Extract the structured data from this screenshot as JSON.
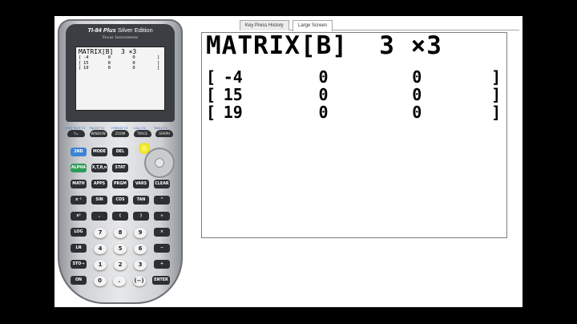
{
  "calculator": {
    "brand": "TI-84 Plus",
    "edition": "Silver Edition",
    "maker": "Texas Instruments",
    "lcd_title": "MATRIX[B]  3 ×3",
    "lcd_rows": [
      [
        "[",
        "-4",
        "0",
        "0",
        "]"
      ],
      [
        "[",
        "15",
        "0",
        "0",
        "]"
      ],
      [
        "[",
        "19",
        "0",
        "0",
        "]"
      ]
    ],
    "fn_keys": [
      "Y=",
      "WINDOW",
      "ZOOM",
      "TRACE",
      "GRAPH"
    ],
    "fn_labels": [
      "STAT PLOT F1",
      "TBLSET F2",
      "FORMAT F3",
      "CALC F4",
      "TABLE F5"
    ],
    "keys": [
      [
        "2ND",
        "MODE",
        "DEL",
        "",
        ""
      ],
      [
        "ALPHA",
        "X,T,θ,n",
        "STAT",
        "",
        ""
      ],
      [
        "MATH",
        "APPS",
        "PRGM",
        "VARS",
        "CLEAR"
      ],
      [
        "x⁻¹",
        "SIN",
        "COS",
        "TAN",
        "^"
      ],
      [
        "x²",
        ",",
        "(",
        ")",
        "÷"
      ],
      [
        "LOG",
        "7",
        "8",
        "9",
        "×"
      ],
      [
        "LN",
        "4",
        "5",
        "6",
        "−"
      ],
      [
        "STO→",
        "1",
        "2",
        "3",
        "+"
      ],
      [
        "ON",
        "0",
        ".",
        "(−)",
        "ENTER"
      ]
    ]
  },
  "tabs": {
    "key_press_history": "Key Press History",
    "large_screen": "Large Screen"
  },
  "large_screen": {
    "title": "MATRIX[B]  3 ×3",
    "rows": [
      [
        "[",
        "-4",
        "0",
        "0",
        "]"
      ],
      [
        "[",
        "15",
        "0",
        "0",
        "]"
      ],
      [
        "[",
        "19",
        "0",
        "0",
        "]"
      ]
    ]
  }
}
